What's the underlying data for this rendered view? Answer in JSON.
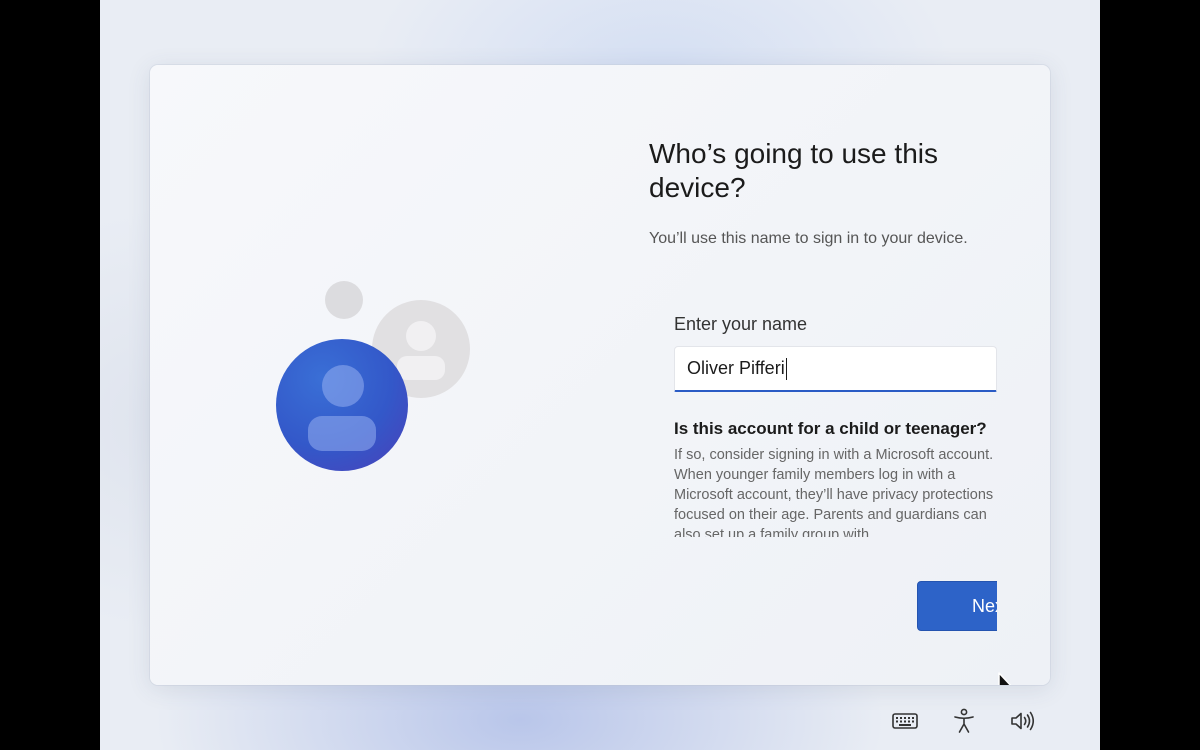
{
  "title": "Who’s going to use this device?",
  "subtitle": "You’ll use this name to sign in to your device.",
  "name_field": {
    "label": "Enter your name",
    "value": "Oliver Pifferi"
  },
  "child_section": {
    "heading": "Is this account for a child or teenager?",
    "body": "If so, consider signing in with a Microsoft account. When younger family members log in with a Microsoft account, they’ll have privacy protections focused on their age. Parents and guardians can also set up a family group with"
  },
  "next_button": {
    "label": "Next"
  },
  "system_icons": [
    "keyboard-icon",
    "accessibility-icon",
    "volume-icon"
  ],
  "colors": {
    "accent": "#2d63c8"
  }
}
